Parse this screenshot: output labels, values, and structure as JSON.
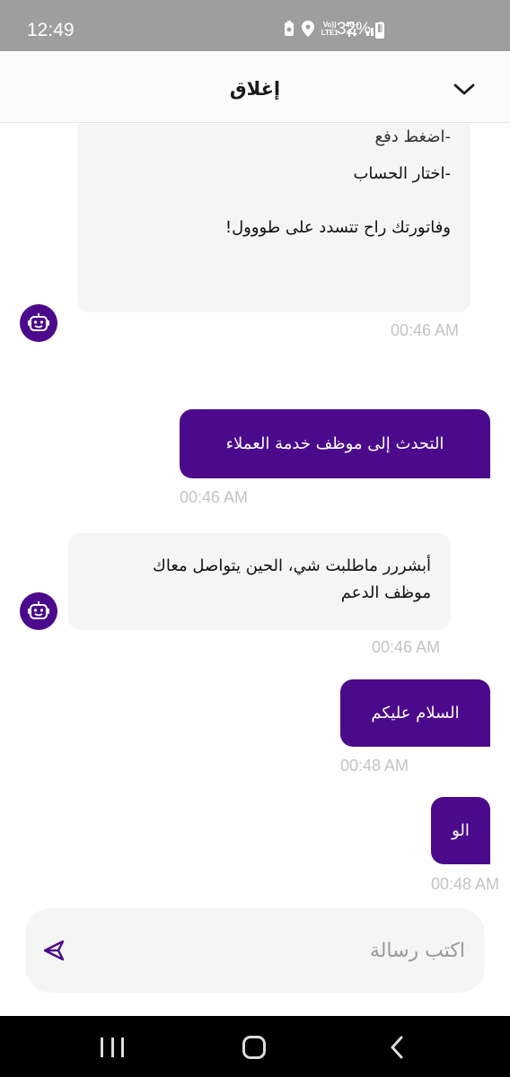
{
  "status_bar": {
    "time": "12:49",
    "network_label_top": "Vo))",
    "network_label_bottom": "LTE1",
    "network_type": "4G+",
    "battery": "32%",
    "icons": [
      "battery-saver-icon",
      "location-icon",
      "volte-icon",
      "data-arrows-icon",
      "signal-icon",
      "battery-icon"
    ]
  },
  "header": {
    "title": "إغلاق",
    "collapse_icon": "chevron-down-icon"
  },
  "messages": [
    {
      "sender": "bot",
      "clipped_top_line": "-اضغط دفع",
      "lines": [
        "-اختار الحساب",
        "وفاتورتك راح تتسدد على طووول!"
      ],
      "time": "00:46 AM"
    },
    {
      "sender": "user",
      "text": "التحدث إلى موظف خدمة العملاء",
      "time": "00:46 AM"
    },
    {
      "sender": "bot",
      "lines": [
        "أبشررر ماطلبت شي، الحين يتواصل معاك",
        "موظف الدعم"
      ],
      "time": "00:46 AM"
    },
    {
      "sender": "user",
      "text": "السلام عليكم",
      "time": "00:48 AM"
    },
    {
      "sender": "user",
      "text": "الو",
      "time": "00:48 AM"
    }
  ],
  "composer": {
    "placeholder": "اكتب رسالة",
    "value": "",
    "send_icon": "send-icon"
  },
  "nav_bar": {
    "icons": [
      "recent-apps-icon",
      "home-icon",
      "back-icon"
    ]
  },
  "colors": {
    "accent": "#4b0a8c",
    "bot_bubble": "#f5f5f5",
    "timestamp": "#c4c4c4",
    "status_bar": "#9e9e9e"
  }
}
